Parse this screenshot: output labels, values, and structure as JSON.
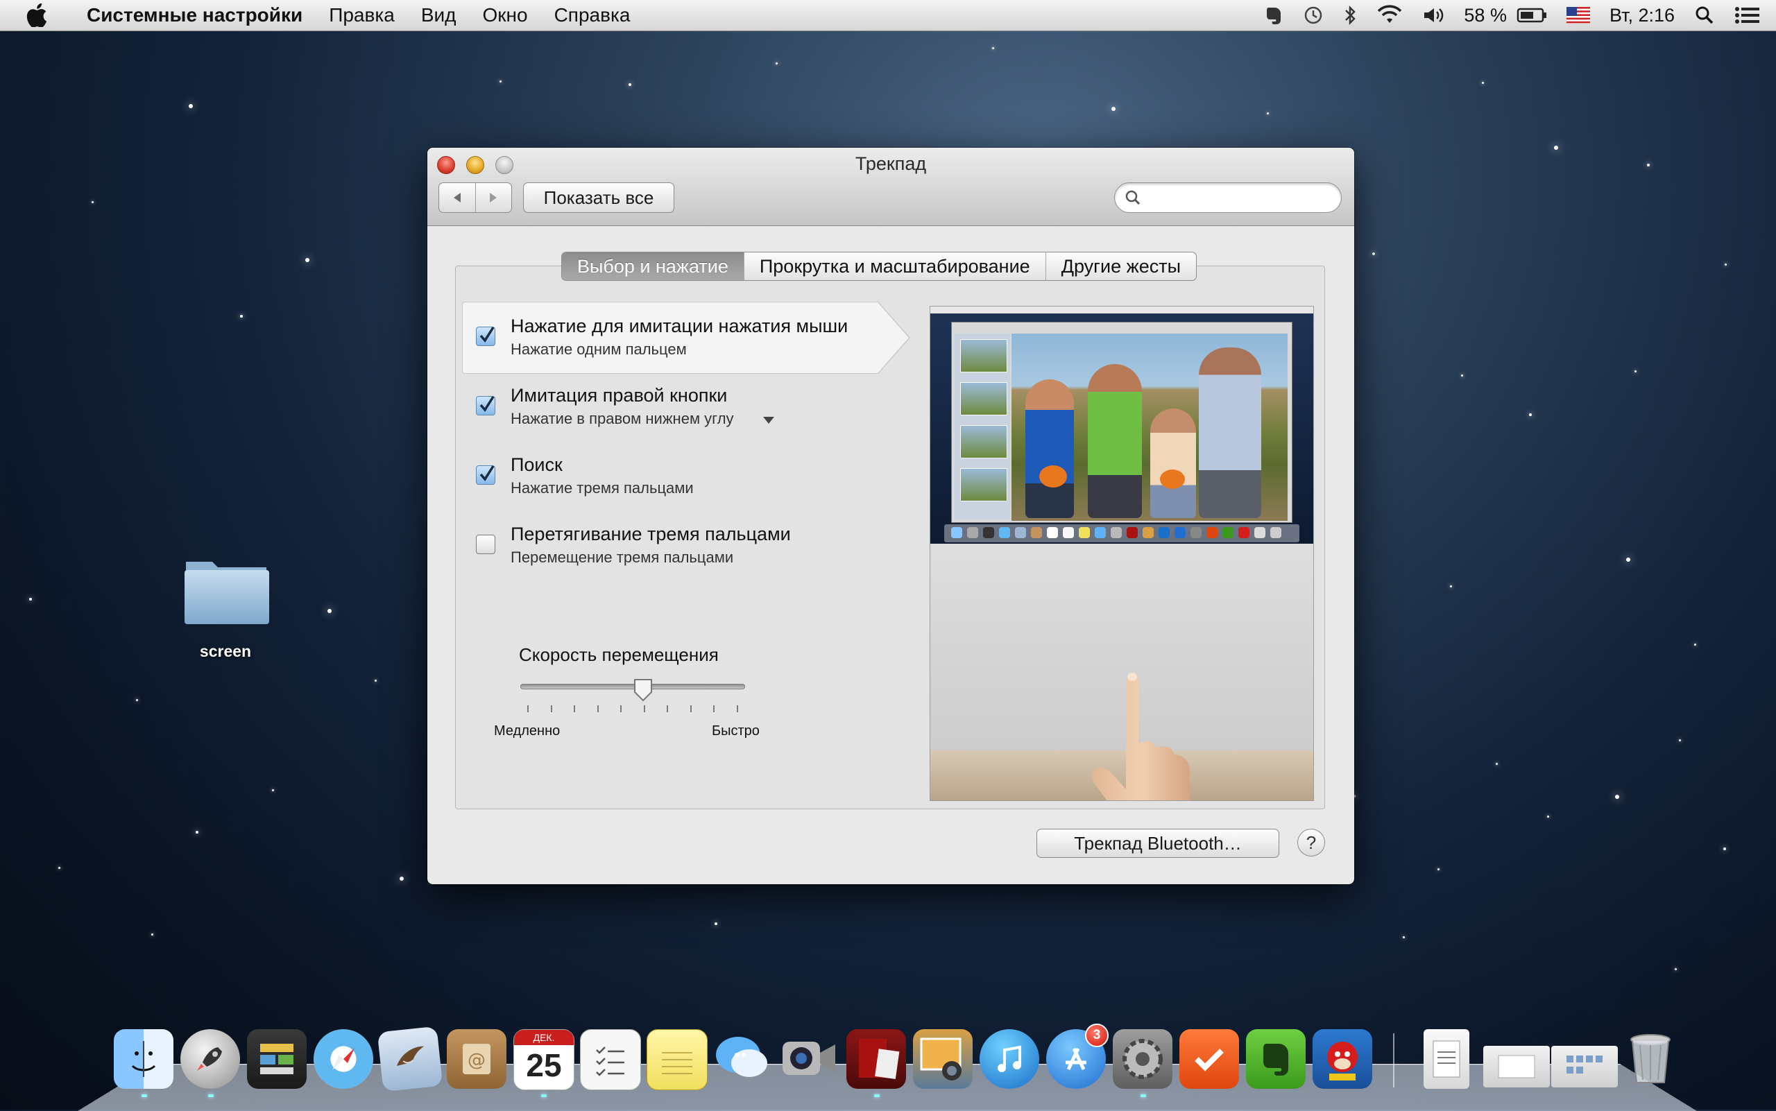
{
  "menubar": {
    "app_name": "Системные настройки",
    "items": [
      "Правка",
      "Вид",
      "Окно",
      "Справка"
    ],
    "battery": "58 %",
    "clock": "Вт, 2:16"
  },
  "window": {
    "title": "Трекпад",
    "show_all": "Показать все",
    "search_placeholder": "",
    "tabs": [
      {
        "label": "Выбор и нажатие",
        "active": true
      },
      {
        "label": "Прокрутка и масштабирование",
        "active": false
      },
      {
        "label": "Другие жесты",
        "active": false
      }
    ],
    "options": [
      {
        "title": "Нажатие для имитации нажатия мыши",
        "subtitle": "Нажатие одним пальцем",
        "checked": true,
        "selected": true
      },
      {
        "title": "Имитация правой кнопки",
        "subtitle": "Нажатие в правом нижнем углу",
        "checked": true,
        "has_dropdown": true
      },
      {
        "title": "Поиск",
        "subtitle": "Нажатие тремя пальцами",
        "checked": true
      },
      {
        "title": "Перетягивание тремя пальцами",
        "subtitle": "Перемещение тремя пальцами",
        "checked": false
      }
    ],
    "speed": {
      "label": "Скорость перемещения",
      "min_label": "Медленно",
      "max_label": "Быстро",
      "value_fraction": 0.55
    },
    "bluetooth_button": "Трекпад Bluetooth…",
    "help_button": "?"
  },
  "desktop": {
    "folder_label": "screen"
  },
  "dock": {
    "items": [
      "finder",
      "launchpad",
      "photo-booth",
      "safari",
      "mail",
      "contacts",
      "calendar",
      "reminders",
      "notes",
      "messages",
      "facetime",
      "photo-viewer",
      "iphoto",
      "itunes",
      "app-store",
      "system-preferences",
      "wunderlist",
      "evernote",
      "angry-birds-seasons"
    ],
    "calendar_day": "25",
    "calendar_month": "ДЕК.",
    "app_store_badge": "3"
  },
  "colors": {
    "accent": "#86b9e8",
    "tab_active": "#9a9a9a"
  }
}
